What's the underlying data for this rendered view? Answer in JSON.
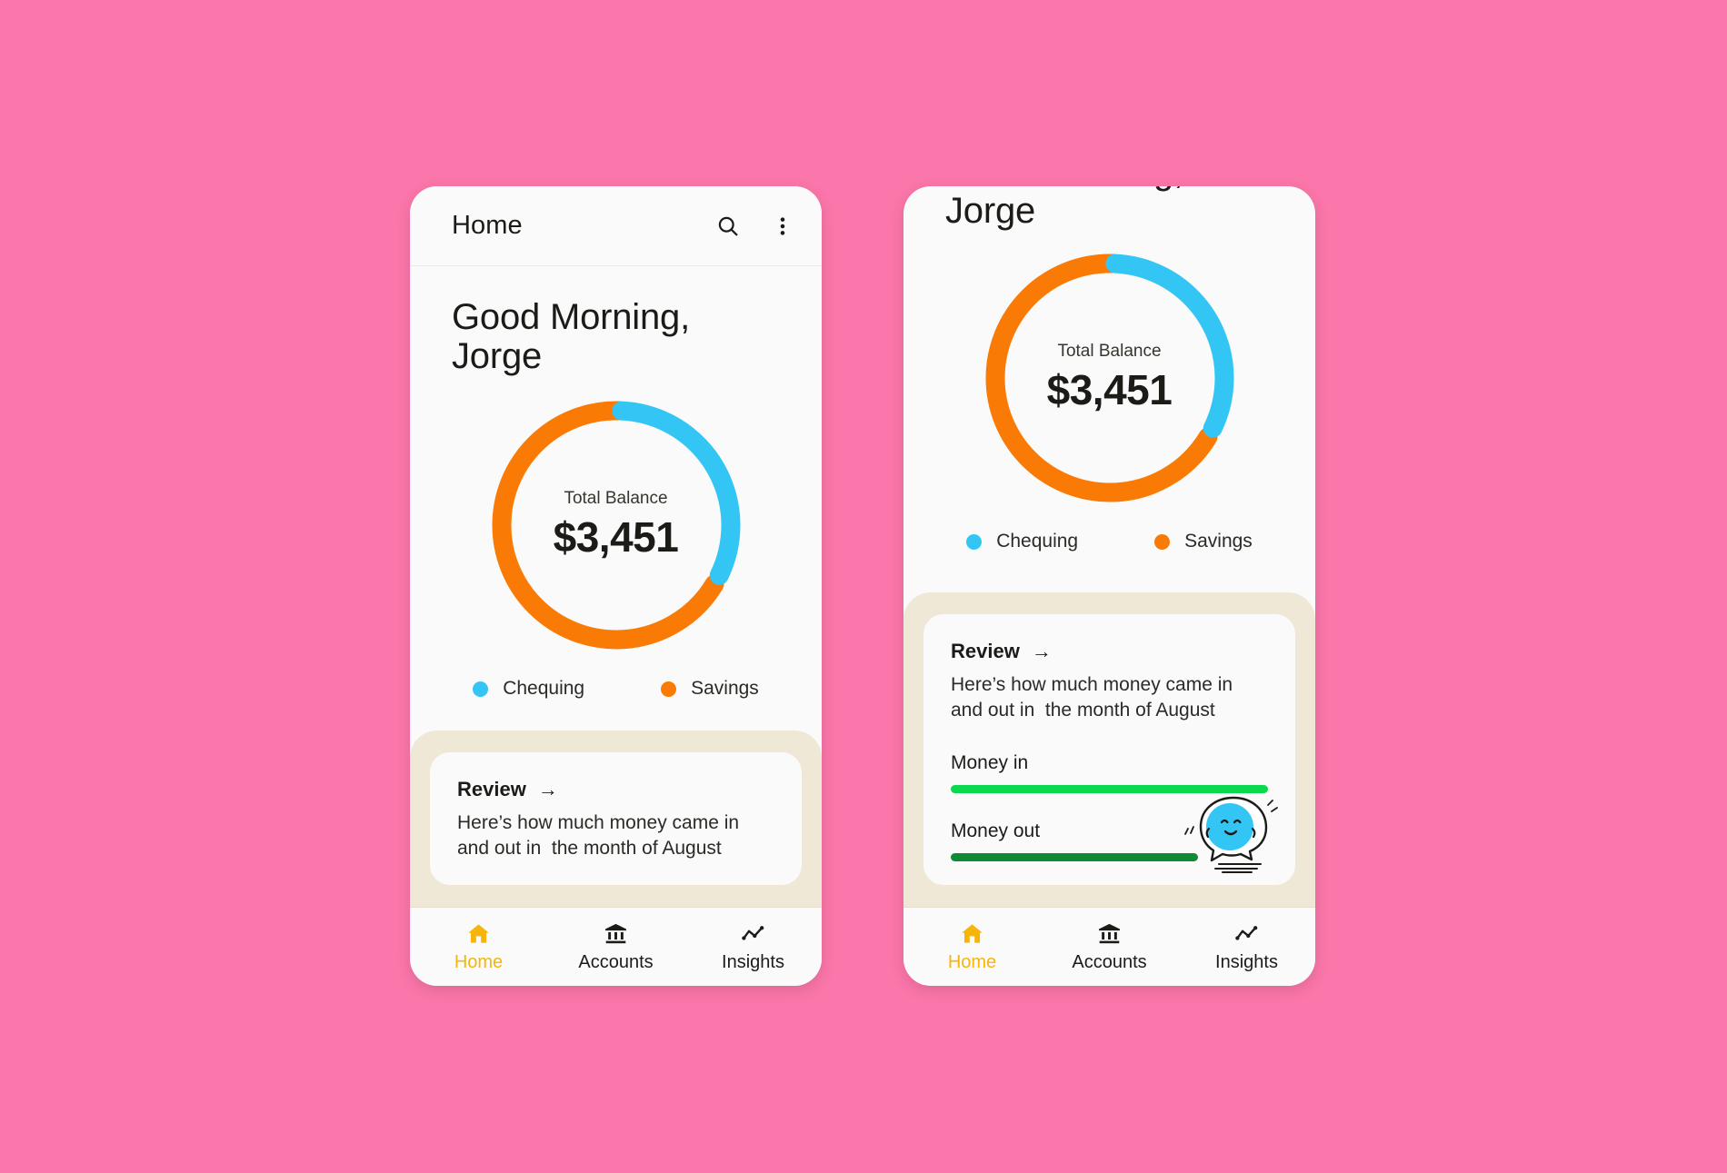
{
  "theme": {
    "background_pink": "#fb76aa",
    "surface": "#fafafa",
    "beige_panel": "#efe8d7",
    "chequing_blue": "#33c6f4",
    "savings_orange": "#f97b06",
    "money_in_green": "#0ad94f",
    "money_out_green": "#0f8a35",
    "active_nav_amber": "#f5b50a",
    "text_primary": "#1d1b18"
  },
  "app_bar": {
    "title": "Home",
    "search_icon": "search-icon",
    "overflow_icon": "more-vertical-icon"
  },
  "greeting": {
    "line1": "Good Morning,",
    "line2": "Jorge"
  },
  "balance": {
    "label": "Total Balance",
    "value": "$3,451"
  },
  "legend": [
    {
      "label": "Chequing",
      "color": "#33c6f4",
      "dot_icon": "legend-dot-icon"
    },
    {
      "label": "Savings",
      "color": "#f97b06",
      "dot_icon": "legend-dot-icon"
    }
  ],
  "review": {
    "title": "Review",
    "arrow": "→",
    "arrow_icon": "arrow-right-icon",
    "description": "Here’s how much money came in and out in  the month of August"
  },
  "money": {
    "rows": [
      {
        "label": "Money in",
        "color": "#0ad94f",
        "percent": 100
      },
      {
        "label": "Money out",
        "color": "#0f8a35",
        "percent": 78
      }
    ],
    "mascot_icon": "blob-mascot-icon"
  },
  "bottom_nav": {
    "items": [
      {
        "label": "Home",
        "icon": "home-icon",
        "active": true
      },
      {
        "label": "Accounts",
        "icon": "bank-icon",
        "active": false
      },
      {
        "label": "Insights",
        "icon": "trending-icon",
        "active": false
      }
    ]
  },
  "chart_data": {
    "type": "pie",
    "title": "Total Balance",
    "subtitle": "$3,451",
    "categories": [
      "Chequing",
      "Savings"
    ],
    "values": [
      32,
      68
    ],
    "colors": [
      "#33c6f4",
      "#f97b06"
    ],
    "units": "percent of total balance",
    "legend_position": "bottom",
    "grid": false,
    "donut": true,
    "start_angle_deg": 0,
    "notes": "Blue (Chequing) arc spans from top clockwise about 116 degrees; orange (Savings) covers the remainder."
  }
}
